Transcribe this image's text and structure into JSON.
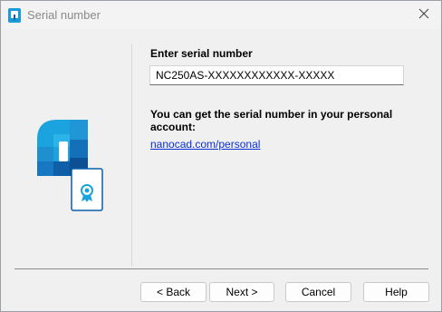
{
  "window": {
    "title": "Serial number",
    "close_icon": "close-icon",
    "app_icon": "nanocad-app-icon"
  },
  "form": {
    "serial_label": "Enter serial number",
    "serial_value": "NC250AS-XXXXXXXXXXXX-XXXXX",
    "info_text": "You can get the serial number in your personal account:",
    "link_text": "nanocad.com/personal"
  },
  "buttons": {
    "back": "< Back",
    "next": "Next >",
    "cancel": "Cancel",
    "help": "Help"
  },
  "colors": {
    "accent": "#0b2fd6",
    "logo_dark": "#0a5aa8",
    "logo_light": "#1fa8e0"
  }
}
